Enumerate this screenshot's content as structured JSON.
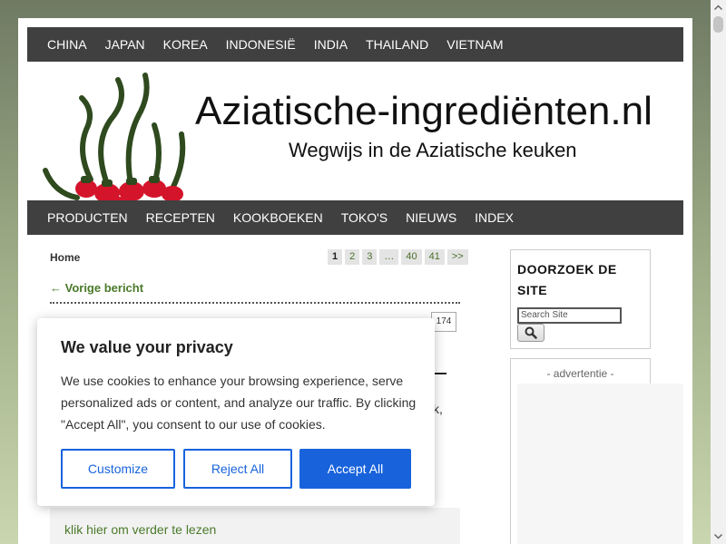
{
  "top_nav": [
    "CHINA",
    "JAPAN",
    "KOREA",
    "INDONESIË",
    "INDIA",
    "THAILAND",
    "VIETNAM"
  ],
  "banner": {
    "title": "Aziatische-ingrediënten.nl",
    "subtitle": "Wegwijs in de Aziatische keuken"
  },
  "main_nav": [
    "PRODUCTEN",
    "RECEPTEN",
    "KOOKBOEKEN",
    "TOKO'S",
    "NIEUWS",
    "INDEX"
  ],
  "breadcrumb": "Home",
  "pagination": [
    "1",
    "2",
    "3",
    "…",
    "40",
    "41",
    ">>"
  ],
  "prev_link": "← Vorige bericht",
  "comment_count": "174",
  "post_fragment": "k,",
  "read_more": "klik hier om verder te lezen",
  "sidebar": {
    "search_title": "DOORZOEK DE SITE",
    "search_placeholder": "Search Site",
    "ad_label": "- advertentie -"
  },
  "cookie": {
    "title": "We value your privacy",
    "text": "We use cookies to enhance your browsing experience, serve personalized ads or content, and analyze our traffic. By clicking \"Accept All\", you consent to our use of cookies.",
    "customize": "Customize",
    "reject": "Reject All",
    "accept": "Accept All"
  },
  "colors": {
    "nav_bg": "#404040",
    "link_green": "#4a7a2a",
    "accent_blue": "#1863dc"
  }
}
